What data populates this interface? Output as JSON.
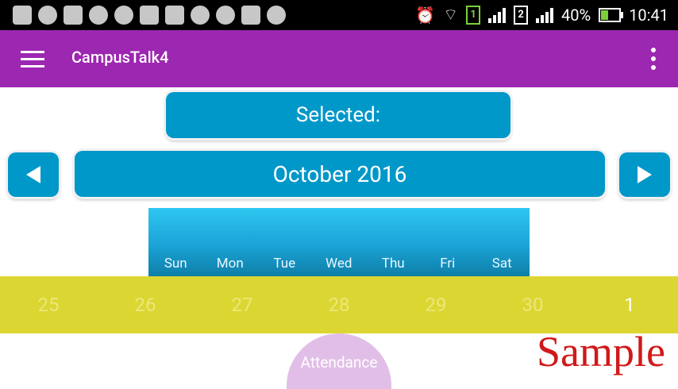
{
  "status_bar": {
    "battery": "40%",
    "battery_level": 0.4,
    "time": "10:41",
    "sim1": "1",
    "sim2": "2"
  },
  "app_bar": {
    "title": "CampusTalk4"
  },
  "selected": {
    "label": "Selected:"
  },
  "calendar": {
    "month_label": "October 2016",
    "weekdays": [
      "Sun",
      "Mon",
      "Tue",
      "Wed",
      "Thu",
      "Fri",
      "Sat"
    ],
    "week_dates": [
      "25",
      "26",
      "27",
      "28",
      "29",
      "30",
      "1"
    ]
  },
  "attendance_button": "Attendance",
  "watermark": "Sample",
  "colors": {
    "app_bar": "#9c27b0",
    "primary_blue": "#0097c9",
    "date_row": "#dcd633",
    "attendance_button": "#e1bee7",
    "watermark": "#d0191a"
  }
}
